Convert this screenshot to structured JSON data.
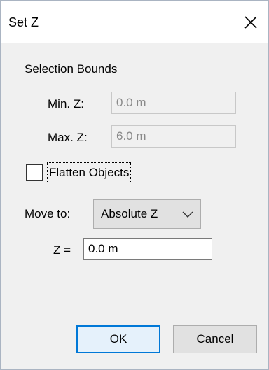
{
  "window": {
    "title": "Set Z"
  },
  "selection_bounds": {
    "title": "Selection Bounds",
    "min_z_label": "Min. Z:",
    "min_z_value": "0.0 m",
    "max_z_label": "Max. Z:",
    "max_z_value": "6.0 m"
  },
  "flatten": {
    "label": "Flatten Objects",
    "checked": false
  },
  "move_to": {
    "label": "Move to:",
    "selected": "Absolute Z"
  },
  "z_field": {
    "label": "Z =",
    "value": "0.0 m"
  },
  "buttons": {
    "ok": "OK",
    "cancel": "Cancel"
  },
  "colors": {
    "accent": "#0078d7",
    "background": "#f0f0f0"
  },
  "icons": {
    "close": "close-icon",
    "dropdown": "chevron-down-icon"
  }
}
